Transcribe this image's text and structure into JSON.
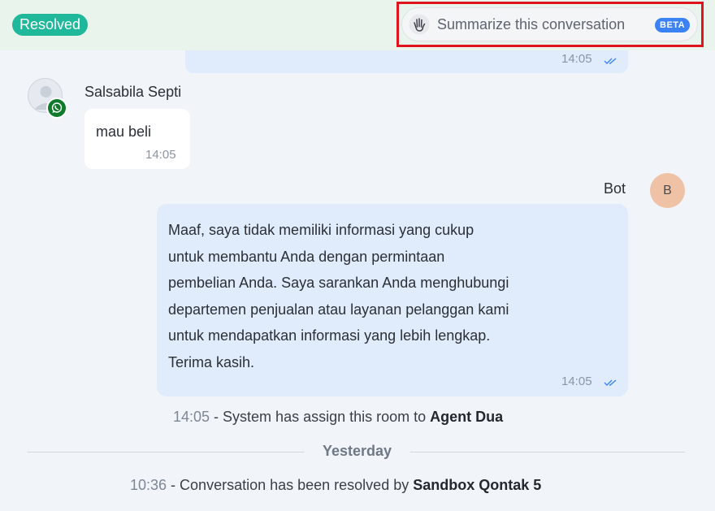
{
  "header": {
    "status_badge": "Resolved",
    "summarize_label": "Summarize this conversation",
    "beta_label": "BETA"
  },
  "messages": [
    {
      "id": "prev",
      "time": "14:05"
    },
    {
      "id": "customer",
      "sender": "Salsabila Septi",
      "text": "mau beli",
      "time": "14:05",
      "channel_icon": "whatsapp-icon"
    },
    {
      "id": "bot",
      "sender": "Bot",
      "avatar_initial": "B",
      "text": " Maaf, saya tidak memiliki informasi yang cukup\nuntuk membantu Anda dengan permintaan\npembelian Anda. Saya sarankan Anda menghubungi\ndepartemen penjualan atau layanan pelanggan kami\nuntuk mendapatkan informasi yang lebih lengkap.\nTerima kasih.",
      "time": "14:05"
    }
  ],
  "system_events": [
    {
      "time": "14:05",
      "text": " - System has assign this room to ",
      "actor": "Agent Dua"
    },
    {
      "time": "10:36",
      "text": " - Conversation has been resolved by ",
      "actor": "Sandbox Qontak 5"
    }
  ],
  "day_separator": "Yesterday",
  "colors": {
    "resolved": "#1fb89a",
    "beta": "#3b82f6",
    "outgoing_bubble": "#e0ecfb",
    "highlight": "#e0141c"
  }
}
